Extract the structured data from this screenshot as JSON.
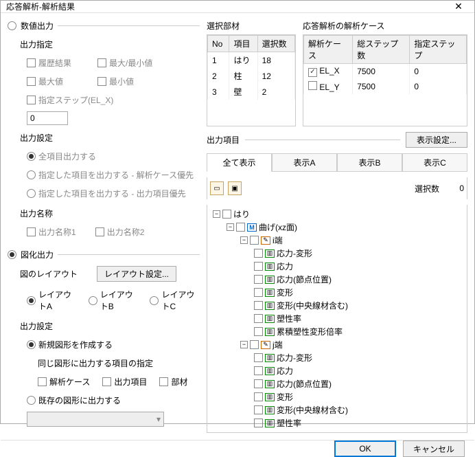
{
  "title": "応答解析-解析結果",
  "left": {
    "numeric_output": "数値出力",
    "output_spec": "出力指定",
    "history": "履歴結果",
    "maxmin": "最大/最小値",
    "max": "最大値",
    "min": "最小値",
    "spec_step": "指定ステップ(EL_X)",
    "step_value": "0",
    "output_setting": "出力設定",
    "all_items": "全項目出力する",
    "spec_items_case": "指定した項目を出力する - 解析ケース優先",
    "spec_items_out": "指定した項目を出力する - 出力項目優先",
    "output_name": "出力名称",
    "name1": "出力名称1",
    "name2": "出力名称2",
    "graphic_output": "図化出力",
    "layout": "図のレイアウト",
    "layout_btn": "レイアウト設定...",
    "layoutA": "レイアウトA",
    "layoutB": "レイアウトB",
    "layoutC": "レイアウトC",
    "new_fig": "新規図形を作成する",
    "same_fig_spec": "同じ図形に出力する項目の指定",
    "case": "解析ケース",
    "out_item": "出力項目",
    "member": "部材",
    "existing_fig": "既存の図形に出力する"
  },
  "right": {
    "sel_member": "選択部材",
    "member_cols": {
      "no": "No",
      "item": "項目",
      "count": "選択数"
    },
    "member_rows": [
      {
        "no": "1",
        "item": "はり",
        "count": "18"
      },
      {
        "no": "2",
        "item": "柱",
        "count": "12"
      },
      {
        "no": "3",
        "item": "壁",
        "count": "2"
      }
    ],
    "case_title": "応答解析の解析ケース",
    "case_cols": {
      "case": "解析ケース",
      "total": "総ステップ数",
      "spec": "指定ステップ"
    },
    "case_rows": [
      {
        "checked": true,
        "name": "EL_X",
        "total": "7500",
        "spec": "0"
      },
      {
        "checked": false,
        "name": "EL_Y",
        "total": "7500",
        "spec": "0"
      }
    ],
    "out_items": "出力項目",
    "disp_setting": "表示設定...",
    "tabs": {
      "all": "全て表示",
      "a": "表示A",
      "b": "表示B",
      "c": "表示C"
    },
    "sel_count_label": "選択数",
    "sel_count": "0",
    "tree": {
      "hari": "はり",
      "mage": "曲げ(xz面)",
      "i_end": "i端",
      "j_end": "j端",
      "items": [
        "応力-変形",
        "応力",
        "応力(節点位置)",
        "変形",
        "変形(中央線材含む)",
        "塑性率",
        "累積塑性変形倍率"
      ],
      "items_j": [
        "応力-変形",
        "応力",
        "応力(節点位置)",
        "変形",
        "変形(中央線材含む)",
        "塑性率"
      ]
    }
  },
  "footer": {
    "ok": "OK",
    "cancel": "キャンセル"
  }
}
